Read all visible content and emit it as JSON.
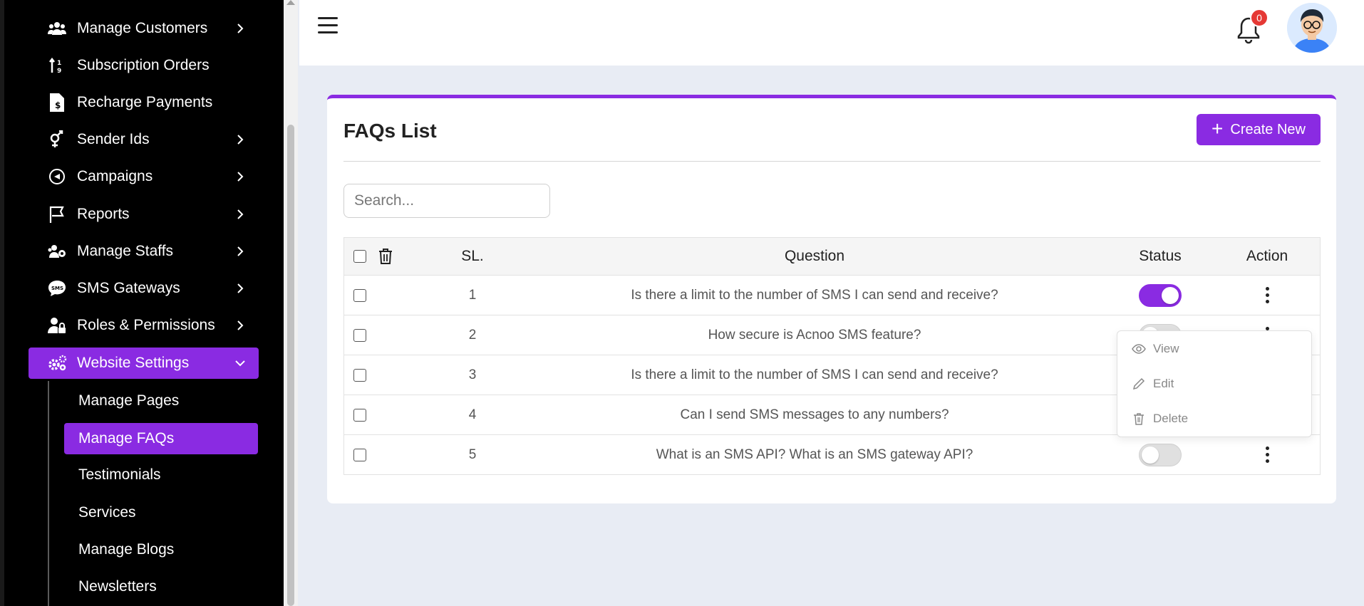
{
  "sidebar": {
    "items": [
      {
        "label": "Manage Customers",
        "icon": "users-icon",
        "chevron": true
      },
      {
        "label": "Subscription Orders",
        "icon": "sort-arrows-icon",
        "chevron": false
      },
      {
        "label": "Recharge Payments",
        "icon": "invoice-icon",
        "chevron": false
      },
      {
        "label": "Sender Ids",
        "icon": "gender-icon",
        "chevron": true
      },
      {
        "label": "Campaigns",
        "icon": "campaign-icon",
        "chevron": true
      },
      {
        "label": "Reports",
        "icon": "flag-icon",
        "chevron": true
      },
      {
        "label": "Manage Staffs",
        "icon": "staff-icon",
        "chevron": true
      },
      {
        "label": "SMS Gateways",
        "icon": "sms-icon",
        "chevron": true
      },
      {
        "label": "Roles & Permissions",
        "icon": "user-lock-icon",
        "chevron": true
      },
      {
        "label": "Website Settings",
        "icon": "cogs-icon",
        "chevron": true,
        "expanded": true,
        "active": true
      }
    ],
    "sub_items": [
      {
        "label": "Manage Pages"
      },
      {
        "label": "Manage FAQs",
        "active": true
      },
      {
        "label": "Testimonials"
      },
      {
        "label": "Services"
      },
      {
        "label": "Manage Blogs"
      },
      {
        "label": "Newsletters"
      }
    ]
  },
  "topbar": {
    "notification_count": "0"
  },
  "card": {
    "title": "FAQs List",
    "create_label": "Create New",
    "search_placeholder": "Search...",
    "columns": {
      "sl": "SL.",
      "question": "Question",
      "status": "Status",
      "action": "Action"
    },
    "rows": [
      {
        "sl": "1",
        "question": "Is there a limit to the number of SMS I can send and receive?",
        "status": true
      },
      {
        "sl": "2",
        "question": "How secure is Acnoo SMS feature?",
        "status": false
      },
      {
        "sl": "3",
        "question": "Is there a limit to the number of SMS I can send and receive?",
        "status": false
      },
      {
        "sl": "4",
        "question": "Can I send SMS messages to any numbers?",
        "status": false
      },
      {
        "sl": "5",
        "question": "What is an SMS API? What is an SMS gateway API?",
        "status": false
      }
    ]
  },
  "dropdown": {
    "view": "View",
    "edit": "Edit",
    "delete": "Delete"
  },
  "colors": {
    "accent": "#8a2be2",
    "badge": "#e53935",
    "sidebar_bg": "#000000"
  }
}
